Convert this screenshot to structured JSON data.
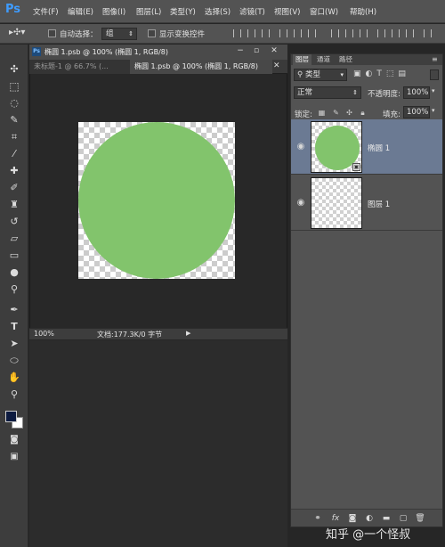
{
  "app": {
    "logo": "Ps"
  },
  "menu": {
    "items": [
      "文件(F)",
      "编辑(E)",
      "图像(I)",
      "图层(L)",
      "类型(Y)",
      "选择(S)",
      "滤镜(T)",
      "视图(V)",
      "窗口(W)",
      "帮助(H)"
    ]
  },
  "options_bar": {
    "auto_select_label": "自动选择：",
    "auto_select_value": "组",
    "show_transform_label": "显示变换控件"
  },
  "document": {
    "window_title": "椭圆 1.psb @ 100% (椭圆 1, RGB/8)",
    "tabs": [
      {
        "label": "未标题-1 @ 66.7% (...",
        "active": false
      },
      {
        "label": "椭圆 1.psb @ 100% (椭圆 1, RGB/8)",
        "active": true
      }
    ],
    "zoom": "100%",
    "doc_info": "文档:177.3K/0 字节"
  },
  "canvas": {
    "shape_color": "#82c46c"
  },
  "layers_panel": {
    "tabs": [
      "图层",
      "通道",
      "路径"
    ],
    "filter_kind": "类型",
    "blend_mode": "正常",
    "opacity_label": "不透明度:",
    "opacity_value": "100%",
    "lock_label": "锁定:",
    "fill_label": "填充:",
    "fill_value": "100%",
    "layers": [
      {
        "name": "椭圆 1",
        "selected": true,
        "visible": true
      },
      {
        "name": "图层 1",
        "selected": false,
        "visible": true
      }
    ],
    "selected_color": "#6b7a93"
  },
  "watermark": "知乎 @一个怪叔"
}
